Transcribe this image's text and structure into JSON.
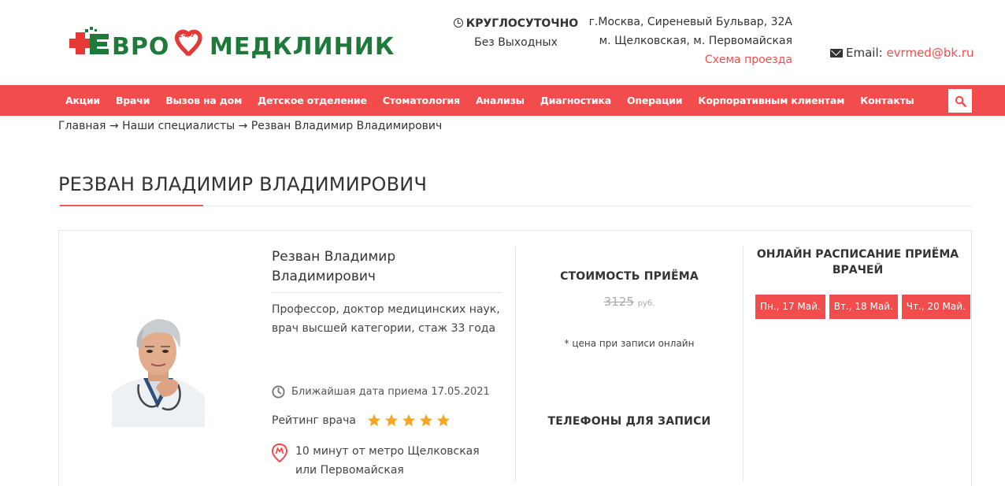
{
  "header": {
    "logo_text": "ЕВРОМЕДКЛИНИК",
    "logo_badge": "24/7",
    "hours_title": "КРУГЛОСУТОЧНО",
    "hours_sub": "Без Выходных",
    "address_line1": "г.Москва, Сиреневый Бульвар, 32А",
    "address_line2": "м. Щелковская, м. Первомайская",
    "route_link": "Схема проезда",
    "email_label": "Email:",
    "email_value": "evrmed@bk.ru",
    "colors": {
      "accent": "#f24c4c",
      "logo_green": "#1e7a3a",
      "logo_red": "#e53935"
    }
  },
  "nav": {
    "items": [
      {
        "label": "Акции"
      },
      {
        "label": "Врачи"
      },
      {
        "label": "Вызов на дом"
      },
      {
        "label": "Детское отделение"
      },
      {
        "label": "Стоматология"
      },
      {
        "label": "Анализы"
      },
      {
        "label": "Диагностика"
      },
      {
        "label": "Операции"
      },
      {
        "label": "Корпоративным клиентам"
      },
      {
        "label": "Контакты"
      }
    ],
    "search_icon": "search-icon"
  },
  "breadcrumb": {
    "text": "Главная → Наши специалисты → Резван Владимир Владимирович"
  },
  "page": {
    "title": "РЕЗВАН ВЛАДИМИР ВЛАДИМИРОВИЧ"
  },
  "doctor": {
    "name": "Резван Владимир Владимирович",
    "description": "Профессор, доктор медицинских наук, врач высшей категории, стаж 33 года",
    "nearest_date": "Ближайшая дата приема 17.05.2021",
    "rating_label": "Рейтинг врача",
    "rating_value": 5,
    "rating_max": 5,
    "metro": "10 минут от метро Щелковская или Первомайская"
  },
  "price": {
    "title": "СТОИМОСТЬ ПРИЁМА",
    "old_value": "3125",
    "currency": "руб.",
    "note": "* цена при записи онлайн",
    "phones_title": "ТЕЛЕФОНЫ ДЛЯ ЗАПИСИ"
  },
  "schedule": {
    "title": "ОНЛАЙН РАСПИСАНИЕ ПРИЁМА ВРАЧЕЙ",
    "days": [
      {
        "label": "Пн., 17 Май."
      },
      {
        "label": "Вт., 18 Май."
      },
      {
        "label": "Чт., 20 Май."
      }
    ]
  }
}
